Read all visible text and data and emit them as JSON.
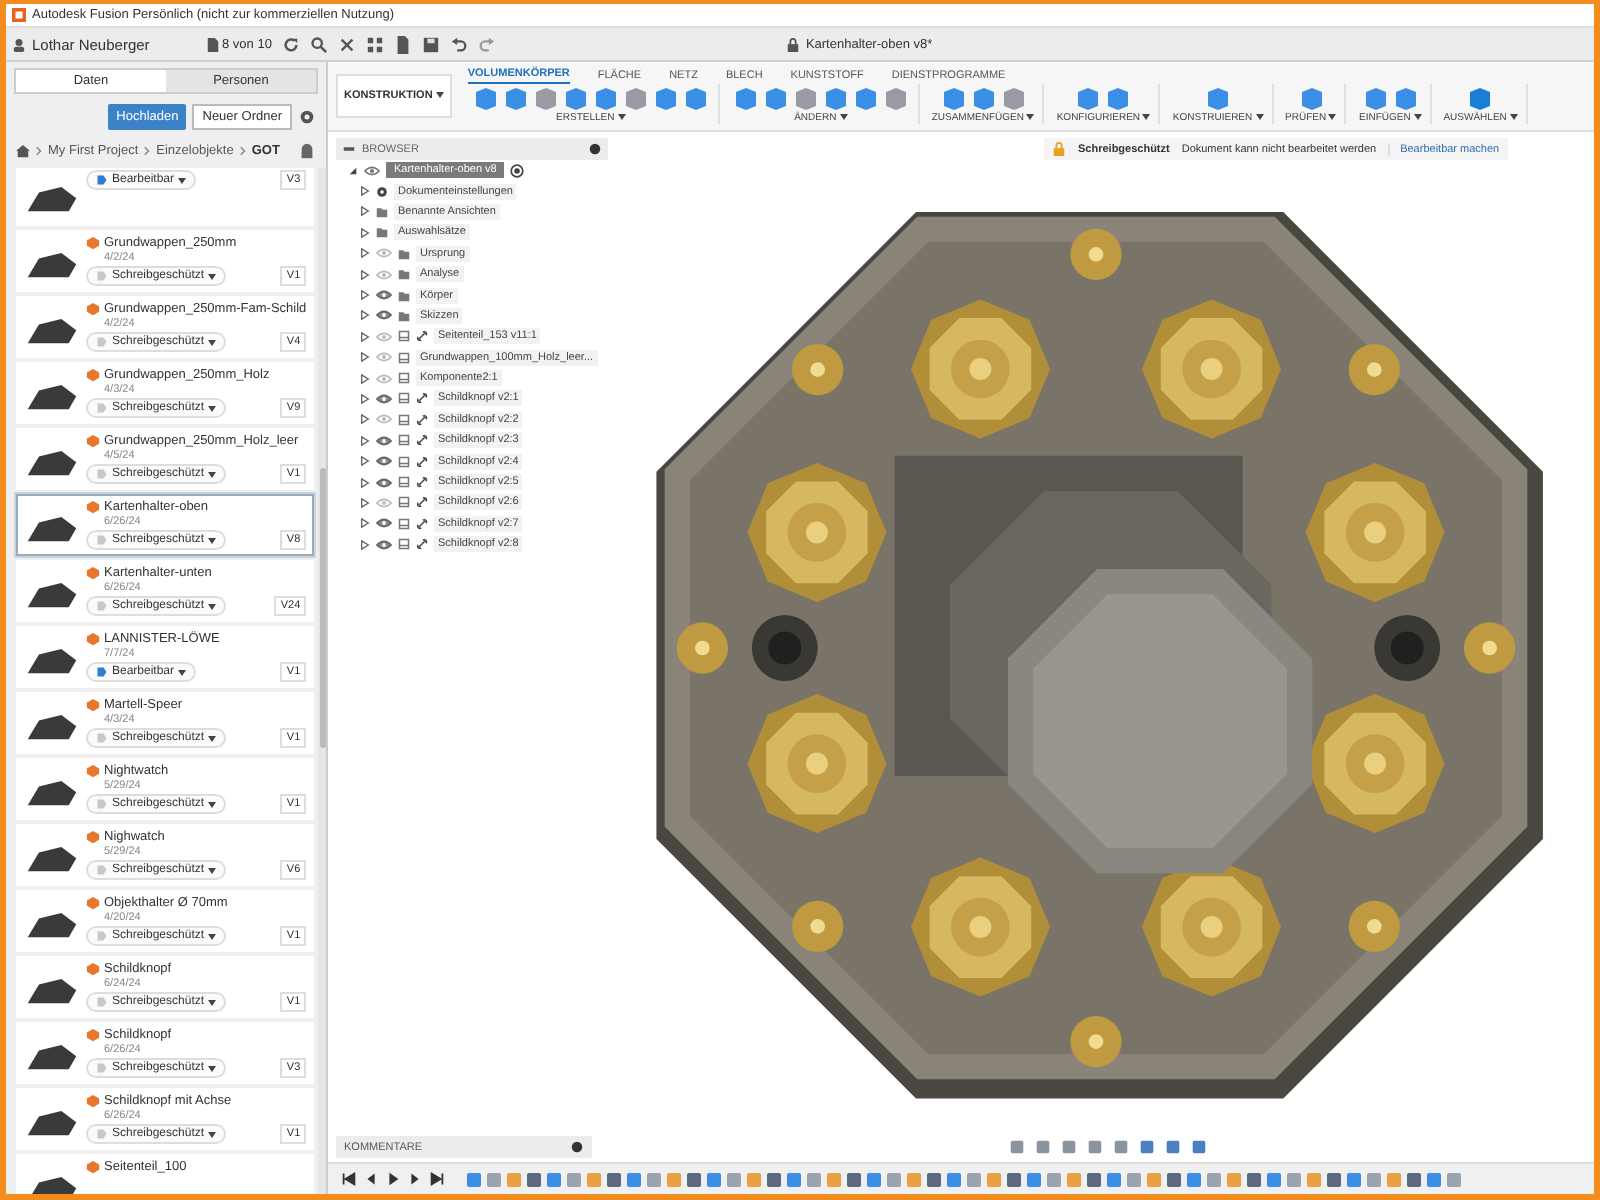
{
  "window": {
    "title": "Autodesk Fusion Persönlich (nicht zur kommerziellen Nutzung)"
  },
  "topbar": {
    "user": "Lothar Neuberger",
    "doc_count": "8 von 10",
    "document_tab": "Kartenhalter-oben v8*"
  },
  "data_panel": {
    "tabs": [
      {
        "label": "Daten",
        "selected": true
      },
      {
        "label": "Personen",
        "selected": false
      }
    ],
    "upload_button": "Hochladen",
    "new_folder_button": "Neuer Ordner",
    "breadcrumb": [
      "My First Project",
      "Einzelobjekte",
      "GOT"
    ],
    "files": [
      {
        "editable": true,
        "status": "Bearbeitbar",
        "version": "V3",
        "selected": false
      },
      {
        "name": "Grundwappen_250mm",
        "date": "4/2/24",
        "editable": false,
        "status": "Schreibgeschützt",
        "version": "V1",
        "selected": false
      },
      {
        "name": "Grundwappen_250mm-Fam-Schild",
        "date": "4/2/24",
        "editable": false,
        "status": "Schreibgeschützt",
        "version": "V4",
        "selected": false
      },
      {
        "name": "Grundwappen_250mm_Holz",
        "date": "4/3/24",
        "editable": false,
        "status": "Schreibgeschützt",
        "version": "V9",
        "selected": false
      },
      {
        "name": "Grundwappen_250mm_Holz_leer",
        "date": "4/5/24",
        "editable": false,
        "status": "Schreibgeschützt",
        "version": "V1",
        "selected": false
      },
      {
        "name": "Kartenhalter-oben",
        "date": "6/26/24",
        "editable": false,
        "status": "Schreibgeschützt",
        "version": "V8",
        "selected": true
      },
      {
        "name": "Kartenhalter-unten",
        "date": "6/26/24",
        "editable": false,
        "status": "Schreibgeschützt",
        "version": "V24",
        "selected": false
      },
      {
        "name": "LANNISTER-LÖWE",
        "date": "7/7/24",
        "editable": true,
        "status": "Bearbeitbar",
        "version": "V1",
        "selected": false
      },
      {
        "name": "Martell-Speer",
        "date": "4/3/24",
        "editable": false,
        "status": "Schreibgeschützt",
        "version": "V1",
        "selected": false
      },
      {
        "name": "Nightwatch",
        "date": "5/29/24",
        "editable": false,
        "status": "Schreibgeschützt",
        "version": "V1",
        "selected": false
      },
      {
        "name": "Nighwatch",
        "date": "5/29/24",
        "editable": false,
        "status": "Schreibgeschützt",
        "version": "V6",
        "selected": false
      },
      {
        "name": "Objekthalter Ø 70mm",
        "date": "4/20/24",
        "editable": false,
        "status": "Schreibgeschützt",
        "version": "V1",
        "selected": false
      },
      {
        "name": "Schildknopf",
        "date": "6/24/24",
        "editable": false,
        "status": "Schreibgeschützt",
        "version": "V1",
        "selected": false
      },
      {
        "name": "Schildknopf",
        "date": "6/26/24",
        "editable": false,
        "status": "Schreibgeschützt",
        "version": "V3",
        "selected": false
      },
      {
        "name": "Schildknopf mit Achse",
        "date": "6/26/24",
        "editable": false,
        "status": "Schreibgeschützt",
        "version": "V1",
        "selected": false
      },
      {
        "name": "Seitenteil_100",
        "selected": false
      }
    ]
  },
  "toolbar": {
    "workspace": "KONSTRUKTION",
    "tabs": [
      {
        "label": "VOLUMENKÖRPER",
        "selected": true
      },
      {
        "label": "FLÄCHE",
        "selected": false
      },
      {
        "label": "NETZ",
        "selected": false
      },
      {
        "label": "BLECH",
        "selected": false
      },
      {
        "label": "KUNSTSTOFF",
        "selected": false
      },
      {
        "label": "DIENSTPROGRAMME",
        "selected": false
      }
    ],
    "groups": [
      {
        "label": "ERSTELLEN"
      },
      {
        "label": "ÄNDERN"
      },
      {
        "label": "ZUSAMMENFÜGEN"
      },
      {
        "label": "KONFIGURIEREN"
      },
      {
        "label": "KONSTRUIEREN"
      },
      {
        "label": "PRÜFEN"
      },
      {
        "label": "EINFÜGEN"
      },
      {
        "label": "AUSWÄHLEN"
      }
    ]
  },
  "banner": {
    "title": "Schreibgeschützt",
    "message": "Dokument kann nicht bearbeitet werden",
    "action": "Bearbeitbar machen"
  },
  "browser": {
    "title": "BROWSER",
    "root": {
      "label": "Kartenhalter-oben v8",
      "expanded": true,
      "children": [
        {
          "label": "Dokumenteinstellungen",
          "kind": "settings",
          "linked": false,
          "expanded": false
        },
        {
          "label": "Benannte Ansichten",
          "kind": "folder",
          "linked": false,
          "expanded": false
        },
        {
          "label": "Auswahlsätze",
          "kind": "folder",
          "linked": false,
          "expanded": false
        },
        {
          "label": "Ursprung",
          "kind": "folder",
          "visible": false,
          "linked": false,
          "expanded": false
        },
        {
          "label": "Analyse",
          "kind": "folder",
          "visible": false,
          "linked": false,
          "expanded": false
        },
        {
          "label": "Körper",
          "kind": "folder",
          "visible": true,
          "linked": false,
          "expanded": false
        },
        {
          "label": "Skizzen",
          "kind": "folder",
          "visible": true,
          "linked": false,
          "expanded": false
        },
        {
          "label": "Seitenteil_153 v11:1",
          "kind": "component",
          "visible": false,
          "linked": true,
          "expanded": false
        },
        {
          "label": "Grundwappen_100mm_Holz_leer...",
          "kind": "component",
          "visible": false,
          "linked": false,
          "expanded": false
        },
        {
          "label": "Komponente2:1",
          "kind": "component",
          "visible": false,
          "linked": false,
          "expanded": false
        },
        {
          "label": "Schildknopf v2:1",
          "kind": "component",
          "visible": true,
          "linked": true,
          "expanded": false
        },
        {
          "label": "Schildknopf v2:2",
          "kind": "component",
          "visible": false,
          "linked": true,
          "expanded": false
        },
        {
          "label": "Schildknopf v2:3",
          "kind": "component",
          "visible": true,
          "linked": true,
          "expanded": false
        },
        {
          "label": "Schildknopf v2:4",
          "kind": "component",
          "visible": true,
          "linked": true,
          "expanded": false
        },
        {
          "label": "Schildknopf v2:5",
          "kind": "component",
          "visible": true,
          "linked": true,
          "expanded": false
        },
        {
          "label": "Schildknopf v2:6",
          "kind": "component",
          "visible": false,
          "linked": true,
          "expanded": false
        },
        {
          "label": "Schildknopf v2:7",
          "kind": "component",
          "visible": true,
          "linked": true,
          "expanded": false
        },
        {
          "label": "Schildknopf v2:8",
          "kind": "component",
          "visible": true,
          "linked": true,
          "expanded": false
        }
      ]
    }
  },
  "comments": {
    "title": "KOMMENTARE"
  }
}
